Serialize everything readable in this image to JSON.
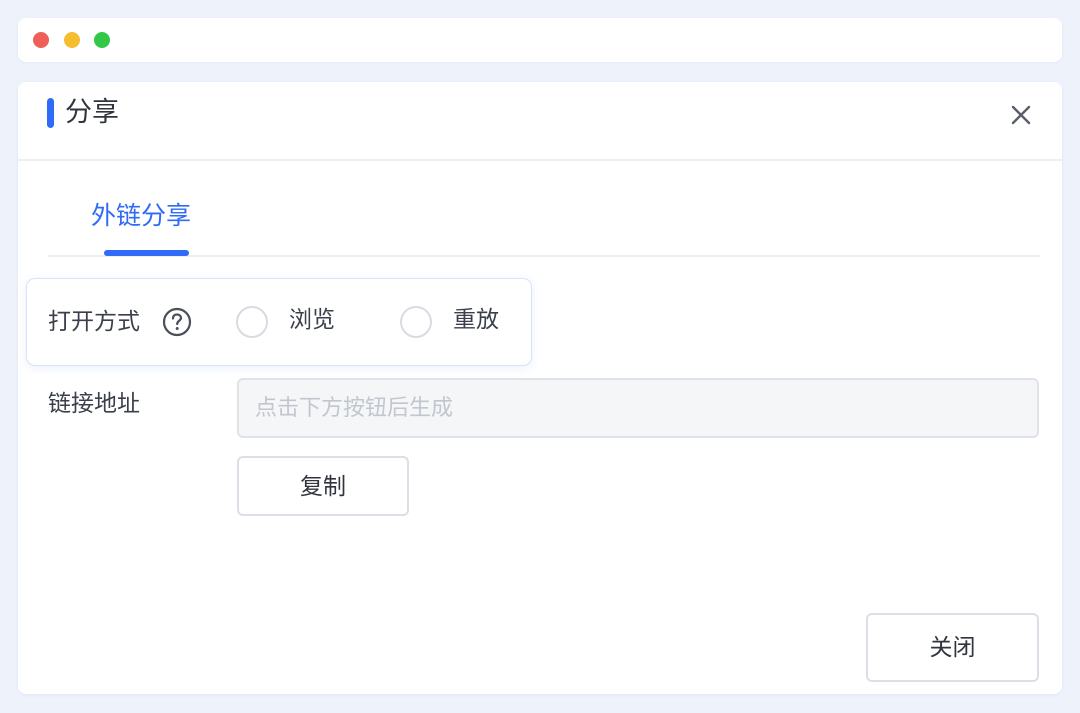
{
  "window": {
    "controls": [
      "close",
      "minimize",
      "maximize"
    ]
  },
  "dialog": {
    "title": "分享",
    "close_icon": "close-icon"
  },
  "tabs": [
    {
      "label": "外链分享",
      "active": true
    }
  ],
  "open_mode": {
    "label": "打开方式",
    "help_icon": "question-circle-icon",
    "options": [
      {
        "label": "浏览",
        "selected": false
      },
      {
        "label": "重放",
        "selected": false
      }
    ]
  },
  "link": {
    "label": "链接地址",
    "value": "",
    "placeholder": "点击下方按钮后生成",
    "copy_label": "复制"
  },
  "footer": {
    "close_label": "关闭"
  },
  "colors": {
    "accent": "#2f6bf6",
    "page_background": "#eef3fb"
  }
}
